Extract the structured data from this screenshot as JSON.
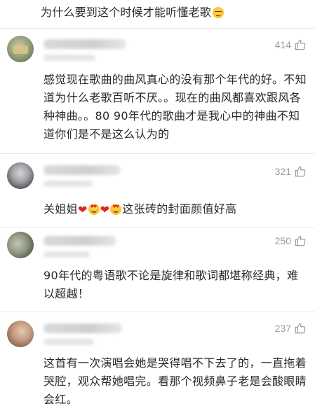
{
  "top_comment": {
    "text": "为什么要到这个时候才能听懂老歌",
    "emoji": "pensive-face-emoji"
  },
  "comments": [
    {
      "likes": "414",
      "text": "感觉现在歌曲的曲风真心的没有那个年代的好。不知道为什么老歌百听不厌。。现在的曲风都喜欢跟风各种神曲。。80 90年代的歌曲才是我心中的神曲不知道你们是不是这么认为的"
    },
    {
      "likes": "321",
      "text_part1": "关姐姐",
      "text_part2": "这张砖的封面颜值好高",
      "emojis": [
        "red-heart-emoji",
        "heart-eyes-emoji",
        "red-heart-emoji",
        "heart-eyes-emoji"
      ]
    },
    {
      "likes": "250",
      "text": "90年代的粤语歌不论是旋律和歌词都堪称经典，难以超越！"
    },
    {
      "likes": "237",
      "text": "这首有一次演唱会她是哭得唱不下去了的，一直拖着哭腔，观众帮她唱完。看那个视频鼻子老是会酸眼睛会红。"
    }
  ],
  "icons": {
    "like": "thumbs-up-icon"
  },
  "colors": {
    "text": "#2a2a2a",
    "likes": "#9a9a9a",
    "heart": "#e0242f",
    "divider": "#e9e9e9"
  }
}
